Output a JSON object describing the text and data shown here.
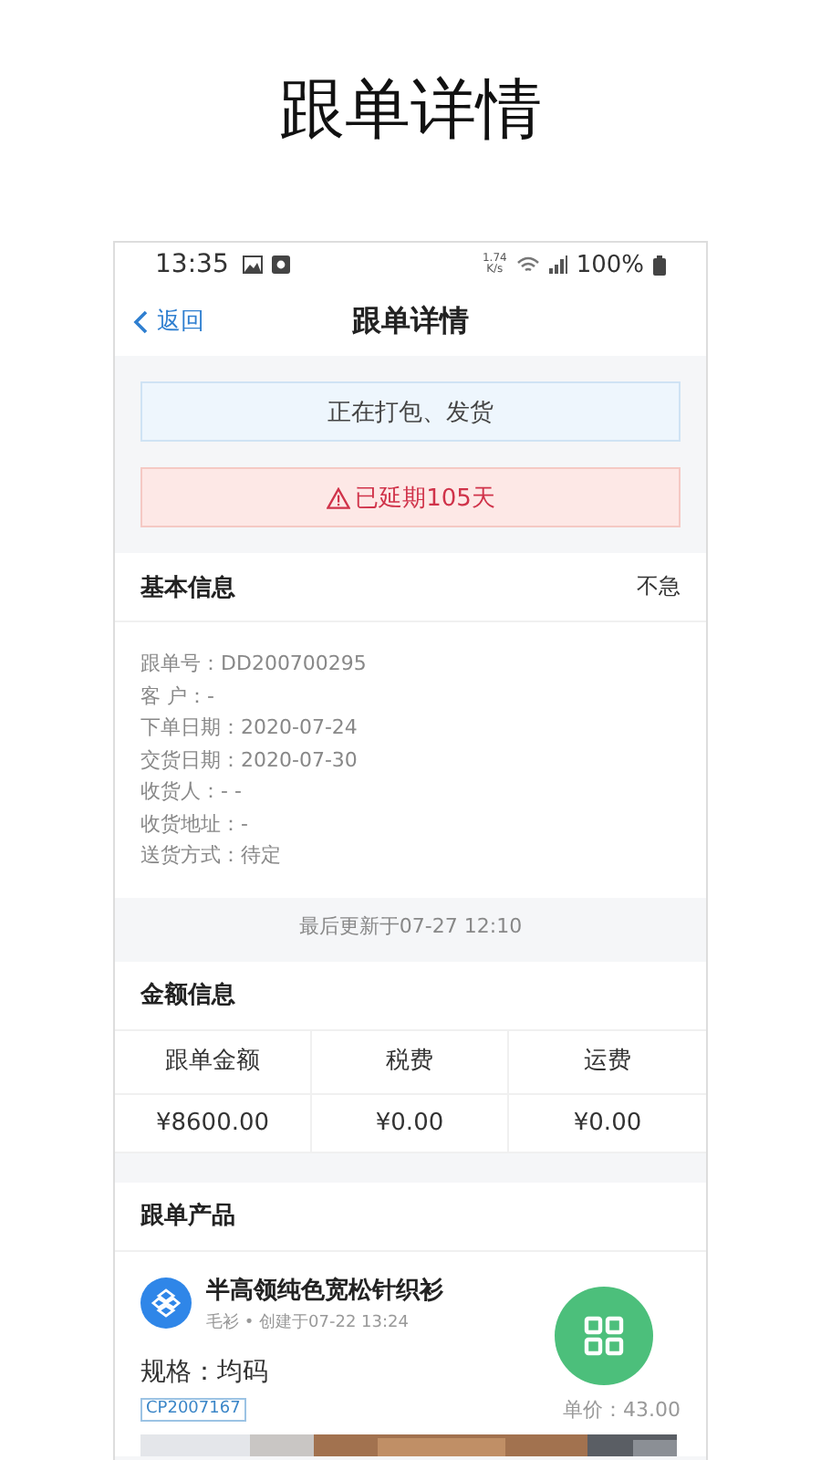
{
  "page_title": "跟单详情",
  "status_bar": {
    "time": "13:35",
    "speed": "1.74",
    "speed_unit": "K/s",
    "battery": "100%"
  },
  "nav": {
    "back": "返回",
    "title": "跟单详情"
  },
  "banners": [
    {
      "kind": "info",
      "text": "正在打包、发货"
    },
    {
      "kind": "warning",
      "text": "已延期105天"
    }
  ],
  "basic_info": {
    "title": "基本信息",
    "urgency": "不急",
    "fields": [
      "跟单号：DD200700295",
      "客 户：-",
      "下单日期：2020-07-24",
      "交货日期：2020-07-30",
      "收货人：-  -",
      "收货地址：-",
      "送货方式：待定"
    ],
    "updated": "最后更新于07-27 12:10"
  },
  "amount_info": {
    "title": "金额信息",
    "columns": [
      "跟单金额",
      "税费",
      "运费"
    ],
    "values": [
      "¥8600.00",
      "¥0.00",
      "¥0.00"
    ]
  },
  "products": {
    "title": "跟单产品",
    "items": [
      {
        "name": "半高领纯色宽松针织衫",
        "meta": "毛衫 • 创建于07-22 13:24",
        "spec": "规格：均码",
        "code": "CP2007167",
        "price": "单价：43.00"
      }
    ]
  }
}
